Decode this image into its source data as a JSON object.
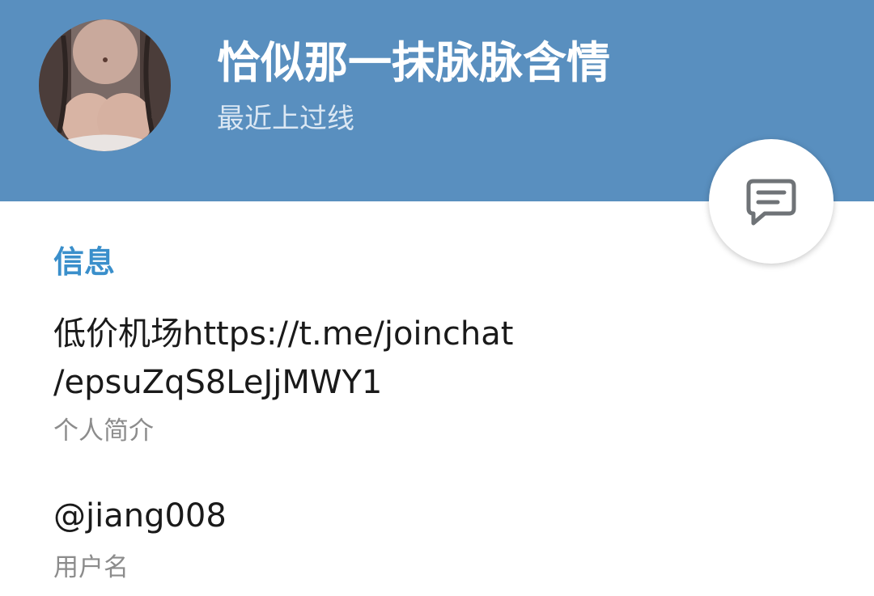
{
  "profile": {
    "name": "恰似那一抹脉脉含情",
    "status": "最近上过线"
  },
  "info_section": {
    "title": "信息",
    "bio_lines": [
      "低价机场https://t.me/joinchat",
      "/epsuZqS8LeJjMWY1"
    ],
    "bio_caption": "个人简介",
    "username": "@jiang008",
    "username_caption": "用户名"
  },
  "colors": {
    "header": "#598fbf",
    "accent": "#3a8fcb",
    "status_text": "#dbe7f3",
    "caption_text": "#8c8c8c"
  },
  "icons": {
    "message_button": "message-icon"
  }
}
